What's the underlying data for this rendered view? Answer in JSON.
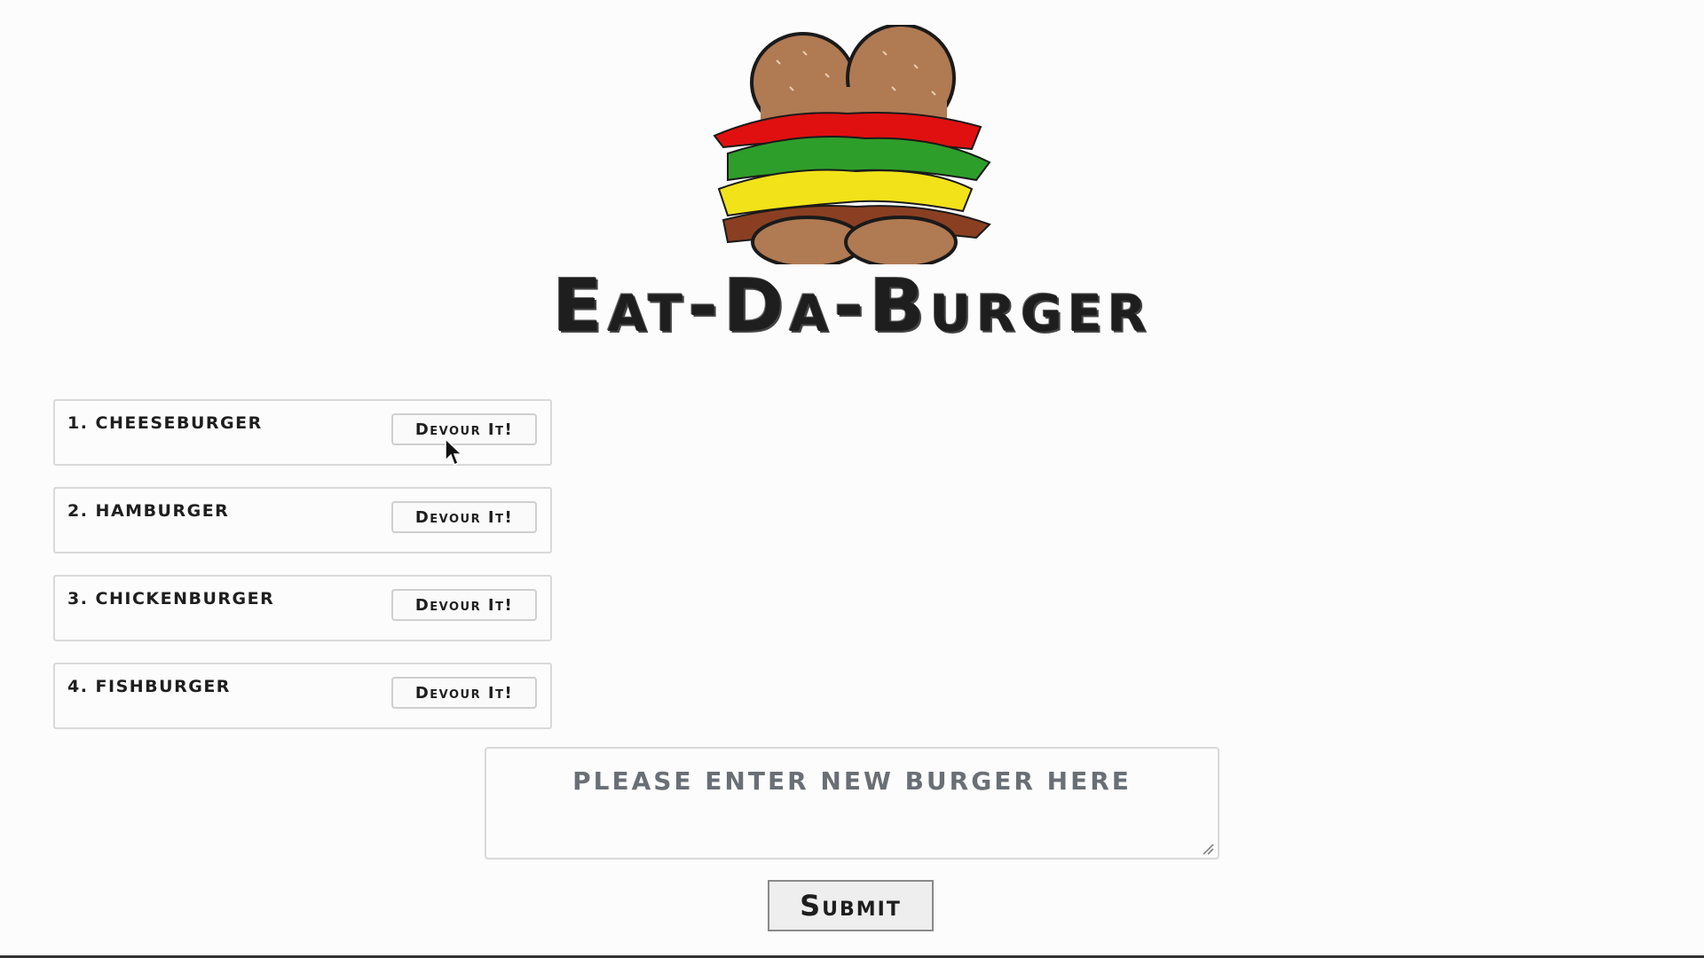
{
  "header": {
    "title": "Eat-Da-Burger",
    "logo_icon": "burger-logo-icon"
  },
  "burgers": [
    {
      "name": "1. Cheeseburger",
      "button_label": "Devour It!"
    },
    {
      "name": "2. Hamburger",
      "button_label": "Devour It!"
    },
    {
      "name": "3. Chickenburger",
      "button_label": "Devour It!"
    },
    {
      "name": "4. Fishburger",
      "button_label": "Devour It!"
    }
  ],
  "form": {
    "placeholder": "please enter new burger here",
    "value": "",
    "submit_label": "Submit"
  },
  "colors": {
    "bun": "#b07a53",
    "lettuce": "#2e9e2a",
    "tomato": "#e01010",
    "cheese": "#f2e21a",
    "patty": "#8a3f22"
  }
}
